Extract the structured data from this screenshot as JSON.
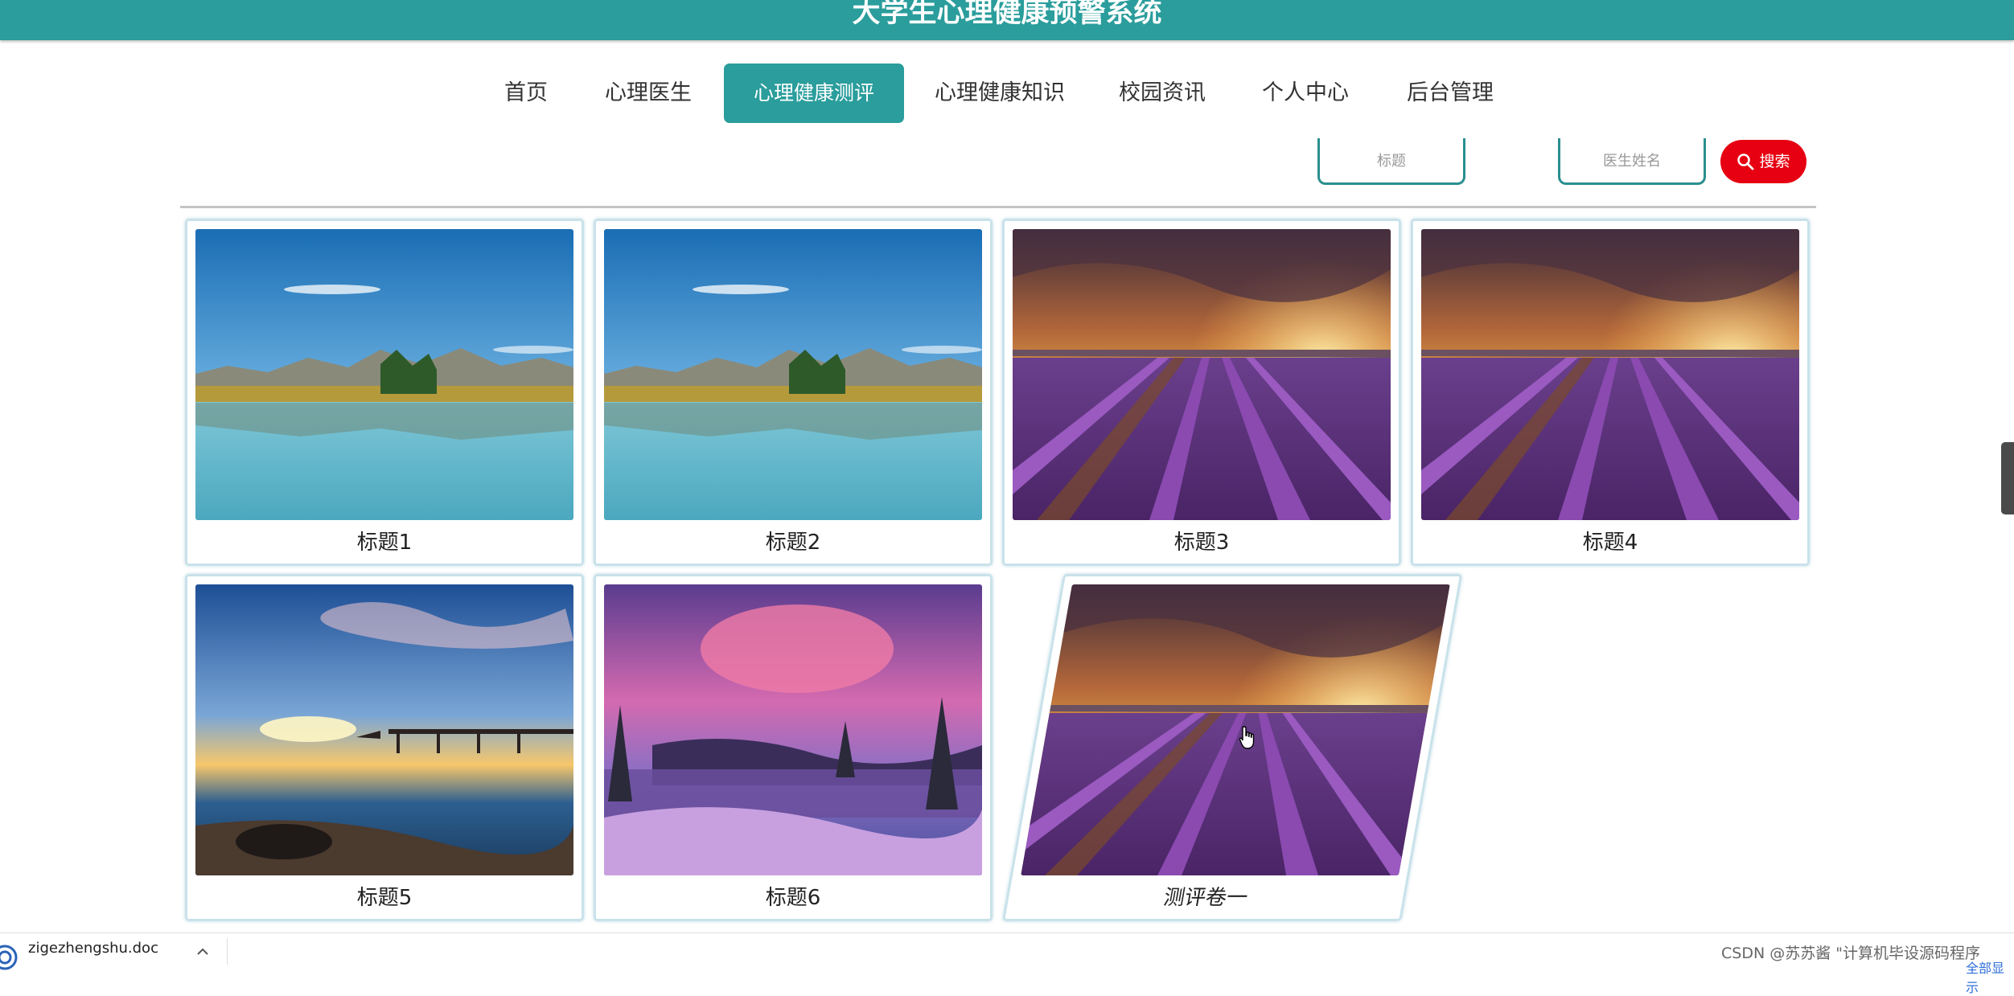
{
  "app": {
    "title": "大学生心理健康预警系统",
    "theme_color": "#2a9d9c"
  },
  "nav": {
    "items": [
      {
        "label": "首页",
        "active": false
      },
      {
        "label": "心理医生",
        "active": false
      },
      {
        "label": "心理健康测评",
        "active": true
      },
      {
        "label": "心理健康知识",
        "active": false
      },
      {
        "label": "校园资讯",
        "active": false
      },
      {
        "label": "个人中心",
        "active": false
      },
      {
        "label": "后台管理",
        "active": false
      }
    ]
  },
  "search": {
    "title_placeholder": "标题",
    "doctor_placeholder": "医生姓名",
    "button_label": "搜索",
    "button_color": "#e60012"
  },
  "cards": [
    {
      "title": "标题1",
      "image": "lake-mountains"
    },
    {
      "title": "标题2",
      "image": "lake-mountains"
    },
    {
      "title": "标题3",
      "image": "lavender-sunset"
    },
    {
      "title": "标题4",
      "image": "lavender-sunset"
    },
    {
      "title": "标题5",
      "image": "pier-sunset"
    },
    {
      "title": "标题6",
      "image": "crater-lake-snow"
    },
    {
      "title": "测评卷一",
      "image": "lavender-sunset",
      "hovered": true
    }
  ],
  "download_bar": {
    "filename": "zigezhengshu.doc",
    "status": "",
    "watermark": "CSDN @苏苏酱  \"计算机毕设源码程序",
    "show_all": "全部显示"
  }
}
